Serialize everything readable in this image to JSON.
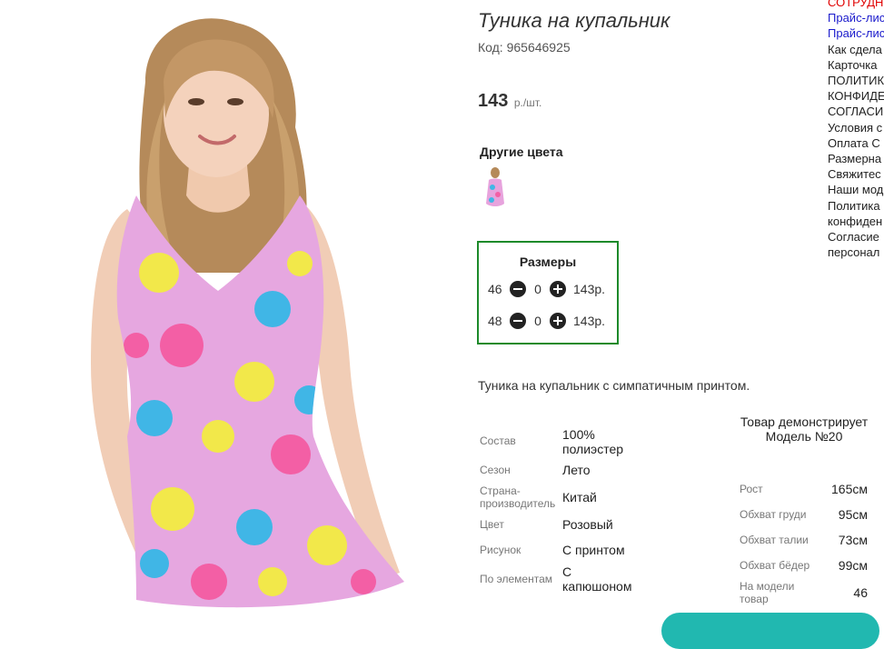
{
  "product": {
    "title": "Туника на купальник",
    "code": "Код: 965646925",
    "price_value": "143",
    "price_unit": "р./шт.",
    "other_colors_label": "Другие цвета",
    "description": "Туника на купальник с симпатичным принтом."
  },
  "sizes": {
    "heading": "Размеры",
    "rows": [
      {
        "size": "46",
        "qty": "0",
        "price": "143р."
      },
      {
        "size": "48",
        "qty": "0",
        "price": "143р."
      }
    ]
  },
  "specs": [
    {
      "label": "Состав",
      "value": "100% полиэстер"
    },
    {
      "label": "Сезон",
      "value": "Лето"
    },
    {
      "label": "Страна-производитель",
      "value": "Китай"
    },
    {
      "label": "Цвет",
      "value": "Розовый"
    },
    {
      "label": "Рисунок",
      "value": "С принтом"
    },
    {
      "label": "По элементам",
      "value": "С капюшоном"
    }
  ],
  "model": {
    "heading": "Товар демонстрирует Модель №20",
    "rows": [
      {
        "label": "Рост",
        "value": "165см"
      },
      {
        "label": "Обхват груди",
        "value": "95см"
      },
      {
        "label": "Обхват талии",
        "value": "73см"
      },
      {
        "label": "Обхват бёдер",
        "value": "99см"
      },
      {
        "label": "На модели товар",
        "value": "46"
      }
    ]
  },
  "side_menu": {
    "items": [
      "СОТРУДН",
      "Прайс-лис",
      "Прайс-лис",
      "Как сдела",
      "Карточка",
      "ПОЛИТИКА",
      "КОНФИДЕ",
      "СОГЛАСИ",
      "Условия с",
      "Оплата С",
      "Размерна",
      "Свяжитес",
      "Наши мод",
      "Политика",
      "конфиден",
      "Согласие",
      "персонал"
    ]
  },
  "colors": {
    "accent_green": "#1d8a2a",
    "menu_red": "#e00000",
    "menu_blue": "#1a1acc",
    "widget_teal": "#21b8b0"
  }
}
